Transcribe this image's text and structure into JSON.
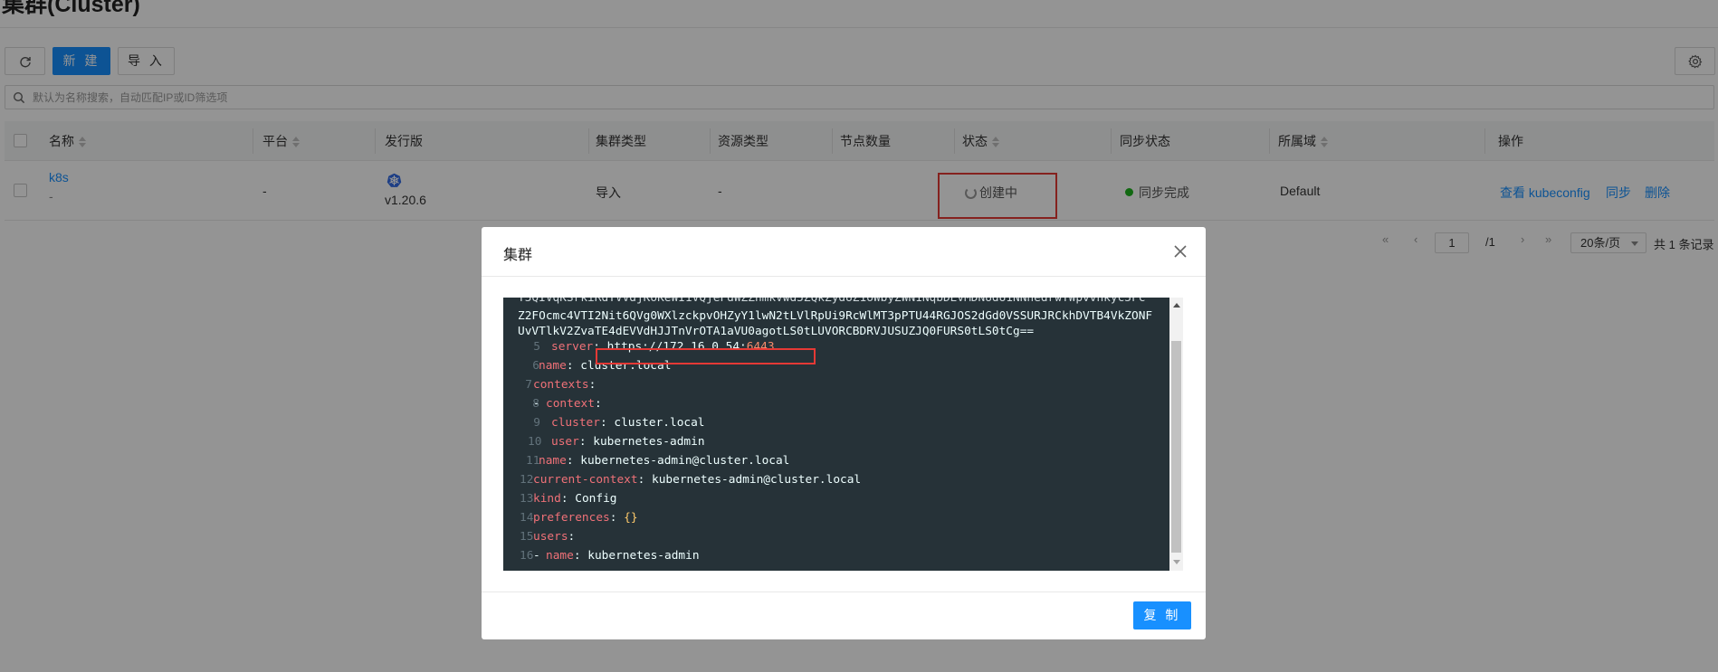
{
  "page": {
    "title": "集群(Cluster)"
  },
  "toolbar": {
    "new_label": "新 建",
    "import_label": "导 入"
  },
  "search": {
    "placeholder": "默认为名称搜索，自动匹配IP或ID筛选项"
  },
  "table": {
    "columns": [
      "名称",
      "平台",
      "发行版",
      "集群类型",
      "资源类型",
      "节点数量",
      "状态",
      "同步状态",
      "所属域",
      "操作"
    ],
    "rows": [
      {
        "name": "k8s",
        "name_sub": "-",
        "platform": "-",
        "distribution_version": "v1.20.6",
        "cluster_type": "导入",
        "resource_type": "-",
        "node_count": "",
        "status": "创建中",
        "sync_status": "同步完成",
        "domain": "Default",
        "actions": [
          "查看 kubeconfig",
          "同步",
          "删除"
        ]
      }
    ]
  },
  "pagination": {
    "current_page": "1",
    "total_pages": "/1",
    "page_size": "20条/页",
    "total_records": "共 1 条记录"
  },
  "modal": {
    "title": "集群",
    "copy_label": "复 制",
    "code": {
      "raw_line_1": "Z2FOcmc4VTI2Nit6QVg0WXlzckpvOHZyY1lwN2tLVlRpUi9RcWlMT3pPTU44RGJOS2dGd0VSSURJRCkhDVTB4VkZONF",
      "raw_line_2": "UvVTlkV2ZvaTE4dEVVdHJJTnVrOTA1aVU0agotLS0tLUVORCBDRVJUSUZJQ0FURS0tLS0tCg==",
      "lines": [
        {
          "num": "5",
          "key": "server",
          "sep": ": ",
          "value": "https://172.16.0.54:",
          "port": "6443"
        },
        {
          "num": "6",
          "key": "name",
          "sep": ": ",
          "value": "cluster.local"
        },
        {
          "num": "7",
          "key": "contexts",
          "sep": ":",
          "value": ""
        },
        {
          "num": "8",
          "key": "context",
          "sep": ":",
          "value": ""
        },
        {
          "num": "9",
          "key": "cluster",
          "sep": ": ",
          "value": "cluster.local"
        },
        {
          "num": "10",
          "key": "user",
          "sep": ": ",
          "value": "kubernetes-admin"
        },
        {
          "num": "11",
          "key": "name",
          "sep": ": ",
          "value": "kubernetes-admin@cluster.local"
        },
        {
          "num": "12",
          "key": "current-context",
          "sep": ": ",
          "value": "kubernetes-admin@cluster.local"
        },
        {
          "num": "13",
          "key": "kind",
          "sep": ": ",
          "value": "Config"
        },
        {
          "num": "14",
          "key": "preferences",
          "sep": ": ",
          "value": "{}"
        },
        {
          "num": "15",
          "key": "users",
          "sep": ":",
          "value": ""
        },
        {
          "num": "16",
          "key": "name",
          "sep": ": ",
          "value": "kubernetes-admin"
        }
      ]
    }
  }
}
